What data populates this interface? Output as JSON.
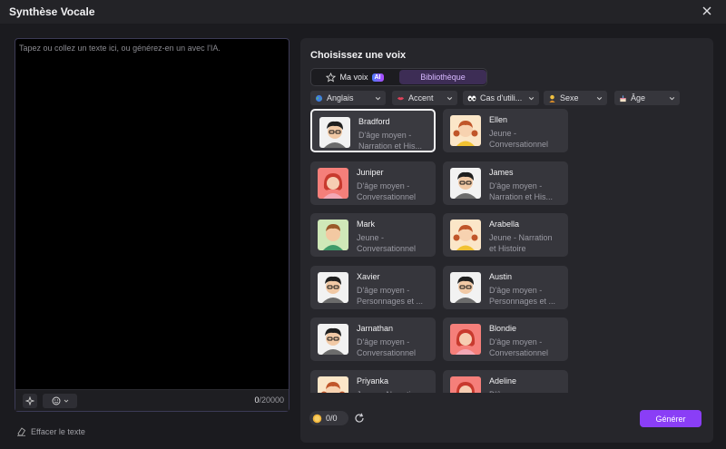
{
  "window": {
    "title": "Synthèse Vocale"
  },
  "editor": {
    "placeholder": "Tapez ou collez un texte ici, ou générez-en un avec l'IA.",
    "value": "",
    "count": "0",
    "max": "/20000",
    "clear_label": "Effacer le texte"
  },
  "voices_panel": {
    "title": "Choisissez une voix",
    "tabs": {
      "my_voice": "Ma voix",
      "ai_badge": "AI",
      "library": "Bibliothèque"
    },
    "filters": {
      "language": "Anglais",
      "accent": "Accent",
      "use_case": "Cas d'utili...",
      "gender": "Sexe",
      "age": "Âge"
    },
    "voices": [
      {
        "name": "Bradford",
        "desc1": "D'âge moyen -",
        "desc2": "Narration et His...",
        "avatar": "man-glasses-avatar",
        "selected": true
      },
      {
        "name": "Ellen",
        "desc1": "Jeune -",
        "desc2": "Conversationnel",
        "avatar": "girl-pigtails-avatar",
        "selected": false
      },
      {
        "name": "Juniper",
        "desc1": "D'âge moyen -",
        "desc2": "Conversationnel",
        "avatar": "woman-red-hair-avatar",
        "selected": false
      },
      {
        "name": "James",
        "desc1": "D'âge moyen -",
        "desc2": "Narration et His...",
        "avatar": "man-glasses-avatar",
        "selected": false
      },
      {
        "name": "Mark",
        "desc1": "Jeune -",
        "desc2": "Conversationnel",
        "avatar": "young-man-avatar",
        "selected": false
      },
      {
        "name": "Arabella",
        "desc1": "Jeune - Narration",
        "desc2": "et Histoire",
        "avatar": "girl-pigtails-avatar",
        "selected": false
      },
      {
        "name": "Xavier",
        "desc1": "D'âge moyen -",
        "desc2": "Personnages et ...",
        "avatar": "man-glasses-avatar",
        "selected": false
      },
      {
        "name": "Austin",
        "desc1": "D'âge moyen -",
        "desc2": "Personnages et ...",
        "avatar": "man-glasses-avatar",
        "selected": false
      },
      {
        "name": "Jarnathan",
        "desc1": "D'âge moyen -",
        "desc2": "Conversationnel",
        "avatar": "man-glasses-avatar",
        "selected": false
      },
      {
        "name": "Blondie",
        "desc1": "D'âge moyen -",
        "desc2": "Conversationnel",
        "avatar": "woman-red-hair-avatar",
        "selected": false
      },
      {
        "name": "Priyanka",
        "desc1": "Jeune - Narration",
        "desc2": "",
        "avatar": "girl-pigtails-avatar",
        "selected": false
      },
      {
        "name": "Adeline",
        "desc1": "D'âge moyen -",
        "desc2": "",
        "avatar": "woman-red-hair-avatar",
        "selected": false
      }
    ],
    "credits": "0/0",
    "generate_label": "Générer"
  },
  "colors": {
    "accent": "#8a3ef6",
    "library_tab_bg": "#3d2d55",
    "library_tab_text": "#d7b8ff"
  }
}
